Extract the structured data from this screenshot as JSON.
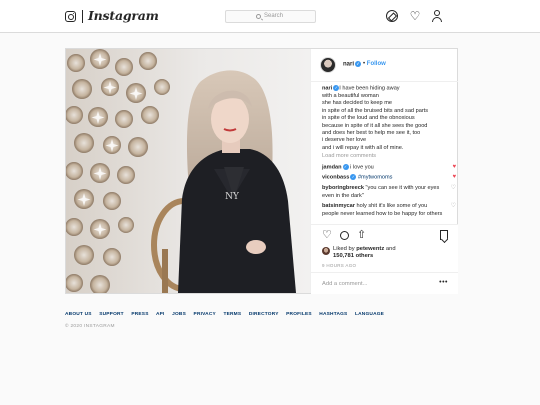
{
  "brand": {
    "name": "Instagram"
  },
  "search": {
    "placeholder": "Search"
  },
  "post": {
    "username": "nari",
    "follow_sep": "•",
    "follow_label": "Follow",
    "caption_user": "nari",
    "caption_lines": [
      "I have been hiding away",
      "with a beautiful woman",
      "she has decided to keep me",
      "in spite of all the bruised bits and sad parts",
      "in spite of the loud and the obnoxious",
      "because in spite of it all she sees the good",
      "and does her best to help me see it, too",
      "i deserve her love",
      "and i will repay it with all of mine."
    ],
    "load_more": "Load more comments",
    "comments": [
      {
        "user": "jamdan",
        "text": "i love you",
        "verified": true,
        "liked": true
      },
      {
        "user": "viconbass",
        "text": "#mytwomoms",
        "verified": true,
        "liked": true
      },
      {
        "user": "byboringbreeck",
        "text": "\"you can see it with your eyes even in the dark\"",
        "verified": false,
        "liked": false
      },
      {
        "user": "batsinmycar",
        "text": "holy shit it's like some of you people never learned how to be happy for others",
        "verified": false,
        "liked": false
      }
    ],
    "likes": {
      "prefix": "Liked by",
      "user": "petewentz",
      "and": "and",
      "others": "150,781 others"
    },
    "time": "9 HOURS AGO",
    "add_comment_placeholder": "Add a comment...",
    "more": "•••"
  },
  "footer": {
    "links": [
      "ABOUT US",
      "SUPPORT",
      "PRESS",
      "API",
      "JOBS",
      "PRIVACY",
      "TERMS",
      "DIRECTORY",
      "PROFILES",
      "HASHTAGS",
      "LANGUAGE"
    ],
    "copyright": "© 2020 INSTAGRAM"
  },
  "colors": {
    "link": "#3897f0",
    "heart": "#ed4956",
    "footer_link": "#003569"
  },
  "icons": [
    "instagram-camera-icon",
    "search-icon",
    "explore-compass-icon",
    "activity-heart-icon",
    "profile-icon",
    "verified-badge-icon",
    "like-heart-icon",
    "comment-icon",
    "share-icon",
    "save-bookmark-icon",
    "more-options-icon"
  ]
}
